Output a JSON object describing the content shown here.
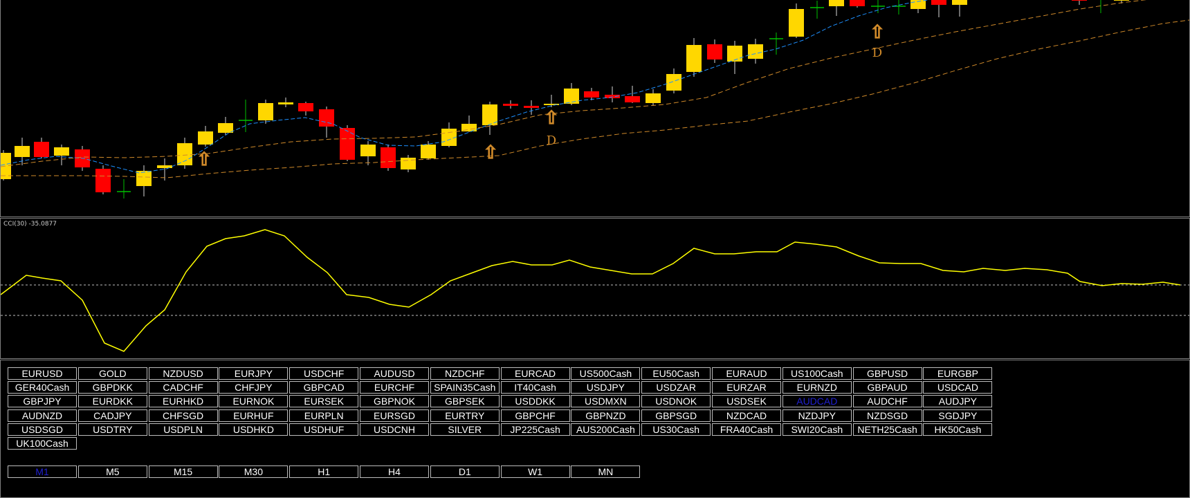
{
  "cci_label": "CCI(30) -35.0877",
  "colors": {
    "bull": "#FFD700",
    "bear": "#FF0000",
    "doji": "#00C000",
    "fast_ma": "#1E90FF",
    "band": "#D08A2A",
    "cci": "#FFFF00",
    "active_button": "#2020D0"
  },
  "signals": {
    "up_arrow": "⇧",
    "d_marker": "D"
  },
  "symbol_rows": [
    [
      "EURUSD",
      "GOLD",
      "NZDUSD",
      "EURJPY",
      "USDCHF",
      "AUDUSD",
      "NZDCHF",
      "EURCAD",
      "US500Cash",
      "EU50Cash",
      "EURAUD",
      "US100Cash",
      "GBPUSD",
      "EURGBP"
    ],
    [
      "GER40Cash",
      "GBPDKK",
      "CADCHF",
      "CHFJPY",
      "GBPCAD",
      "EURCHF",
      "SPAIN35Cash",
      "IT40Cash",
      "USDJPY",
      "USDZAR",
      "EURZAR",
      "EURNZD",
      "GBPAUD",
      "USDCAD"
    ],
    [
      "GBPJPY",
      "EURDKK",
      "EURHKD",
      "EURNOK",
      "EURSEK",
      "GBPNOK",
      "GBPSEK",
      "USDDKK",
      "USDMXN",
      "USDNOK",
      "USDSEK",
      "AUDCAD",
      "AUDCHF",
      "AUDJPY"
    ],
    [
      "AUDNZD",
      "CADJPY",
      "CHFSGD",
      "EURHUF",
      "EURPLN",
      "EURSGD",
      "EURTRY",
      "GBPCHF",
      "GBPNZD",
      "GBPSGD",
      "NZDCAD",
      "NZDJPY",
      "NZDSGD",
      "SGDJPY"
    ],
    [
      "USDSGD",
      "USDTRY",
      "USDPLN",
      "USDHKD",
      "USDHUF",
      "USDCNH",
      "SILVER",
      "JP225Cash",
      "AUS200Cash",
      "US30Cash",
      "FRA40Cash",
      "SWI20Cash",
      "NETH25Cash",
      "HK50Cash"
    ],
    [
      "UK100Cash"
    ]
  ],
  "active_symbol": "AUDCAD",
  "timeframes": [
    "M1",
    "M5",
    "M15",
    "M30",
    "H1",
    "H4",
    "D1",
    "W1",
    "MN"
  ],
  "active_timeframe": "M1"
}
